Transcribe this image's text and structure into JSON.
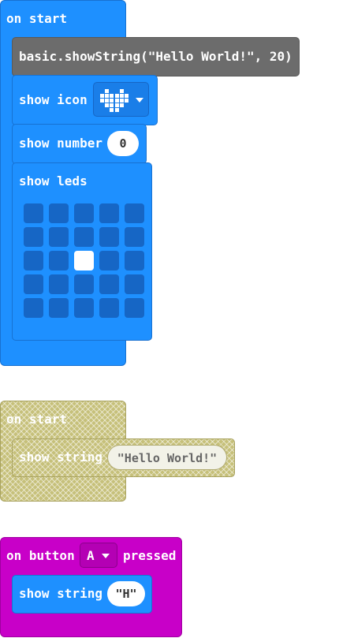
{
  "group1": {
    "hat_label": "on start",
    "basic_text": "basic.showString(\"Hello World!\", 20)",
    "show_icon_label": "show icon",
    "icon_name": "heart-icon",
    "show_number_label": "show number",
    "number_value": "0",
    "show_leds_label": "show leds",
    "leds": [
      [
        0,
        0,
        0,
        0,
        0
      ],
      [
        0,
        0,
        0,
        0,
        0
      ],
      [
        0,
        0,
        1,
        0,
        0
      ],
      [
        0,
        0,
        0,
        0,
        0
      ],
      [
        0,
        0,
        0,
        0,
        0
      ]
    ]
  },
  "group2": {
    "hat_label": "on start",
    "show_string_label": "show string",
    "string_value": "\"Hello World!\""
  },
  "group3": {
    "on_label": "on button",
    "button_value": "A",
    "pressed_label": "pressed",
    "show_string_label": "show string",
    "string_value": "\"H\""
  },
  "colors": {
    "blue": "#1e90ff",
    "gray": "#6c6c6c",
    "magenta": "#c800c8",
    "disabled": "#c6c07a"
  }
}
